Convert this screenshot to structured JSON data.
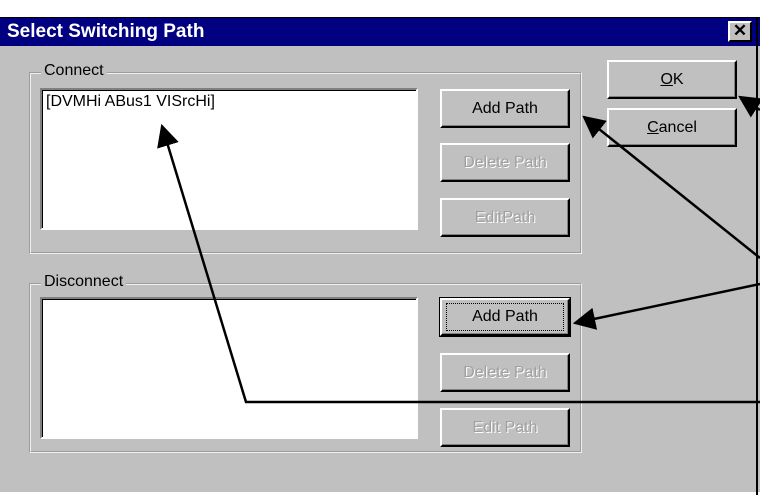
{
  "window": {
    "title": "Select Switching Path",
    "close_glyph": "✕"
  },
  "connect": {
    "label": "Connect",
    "items": [
      "[DVMHi ABus1 VISrcHi]"
    ],
    "buttons": {
      "add": "Add Path",
      "delete": "Delete Path",
      "edit": "EditPath"
    }
  },
  "disconnect": {
    "label": "Disconnect",
    "items": [],
    "buttons": {
      "add": "Add Path",
      "delete": "Delete Path",
      "edit": "Edit Path"
    }
  },
  "dialog_buttons": {
    "ok_prefix": "O",
    "ok_rest": "K",
    "cancel_prefix": "C",
    "cancel_rest": "ancel"
  },
  "icons": {
    "close": "close-icon",
    "callout_arrows": "arrow-icon"
  },
  "colors": {
    "title_bar": "#000080",
    "dialog_face": "#c0c0c0",
    "disabled_text": "#a0a0a0"
  }
}
